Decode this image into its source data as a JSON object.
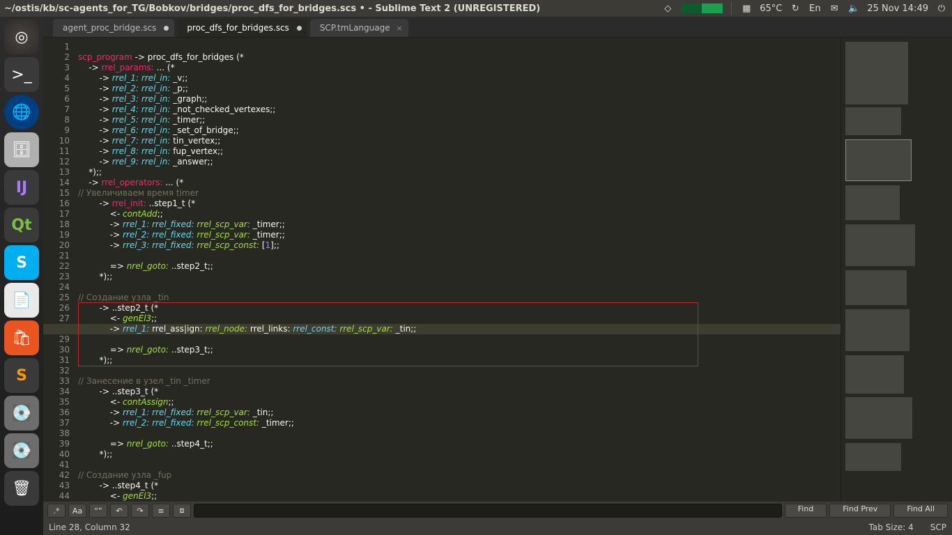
{
  "menubar": {
    "title": "~/ostis/kb/sc-agents_for_TG/Bobkov/bridges/proc_dfs_for_bridges.scs • - Sublime Text 2 (UNREGISTERED)",
    "temp": "65°C",
    "lang": "En",
    "datetime": "25 Nov 14:49"
  },
  "launcher": {
    "items": [
      {
        "name": "ubuntu-dash",
        "glyph": "◎"
      },
      {
        "name": "terminal",
        "glyph": ">_"
      },
      {
        "name": "firefox",
        "glyph": "🦊"
      },
      {
        "name": "files",
        "glyph": "🗄"
      },
      {
        "name": "intellij",
        "glyph": "IJ"
      },
      {
        "name": "qt-creator",
        "glyph": "Qt"
      },
      {
        "name": "skype",
        "glyph": "S"
      },
      {
        "name": "libreoffice-writer",
        "glyph": "📄"
      },
      {
        "name": "software-center",
        "glyph": "🛍"
      },
      {
        "name": "sublime-text",
        "glyph": "S"
      },
      {
        "name": "disk-1",
        "glyph": "💽"
      },
      {
        "name": "disk-2",
        "glyph": "💽"
      },
      {
        "name": "trash",
        "glyph": "🗑"
      }
    ]
  },
  "tabs": [
    {
      "label": "agent_proc_bridge.scs",
      "state": "dirty"
    },
    {
      "label": "proc_dfs_for_bridges.scs",
      "state": "dirty",
      "active": true
    },
    {
      "label": "SCP.tmLanguage",
      "state": "close"
    }
  ],
  "code": {
    "lines": [
      {
        "n": 1,
        "html": ""
      },
      {
        "n": 2,
        "html": "<span class='kw1'>scp_program</span><span class='id'> -&gt; proc_dfs_for_bridges (*</span>"
      },
      {
        "n": 3,
        "html": "<span class='id'>    -&gt; </span><span class='kw1'>rrel_params:</span><span class='id'> ... (*</span>"
      },
      {
        "n": 4,
        "html": "<span class='id'>        -&gt; </span><span class='ty'>rrel_1:</span><span class='id'> </span><span class='ty'>rrel_in:</span><span class='id'> _v;;</span>"
      },
      {
        "n": 5,
        "html": "<span class='id'>        -&gt; </span><span class='ty'>rrel_2:</span><span class='id'> </span><span class='ty'>rrel_in:</span><span class='id'> _p;;</span>"
      },
      {
        "n": 6,
        "html": "<span class='id'>        -&gt; </span><span class='ty'>rrel_3:</span><span class='id'> </span><span class='ty'>rrel_in:</span><span class='id'> _graph;;</span>"
      },
      {
        "n": 7,
        "html": "<span class='id'>        -&gt; </span><span class='ty'>rrel_4:</span><span class='id'> </span><span class='ty'>rrel_in:</span><span class='id'> _not_checked_vertexes;;</span>"
      },
      {
        "n": 8,
        "html": "<span class='id'>        -&gt; </span><span class='ty'>rrel_5:</span><span class='id'> </span><span class='ty'>rrel_in:</span><span class='id'> _timer;;</span>"
      },
      {
        "n": 9,
        "html": "<span class='id'>        -&gt; </span><span class='ty'>rrel_6:</span><span class='id'> </span><span class='ty'>rrel_in:</span><span class='id'> _set_of_bridge;;</span>"
      },
      {
        "n": 10,
        "html": "<span class='id'>        -&gt; </span><span class='ty'>rrel_7:</span><span class='id'> </span><span class='ty'>rrel_in:</span><span class='id'> tin_vertex;;</span>"
      },
      {
        "n": 11,
        "html": "<span class='id'>        -&gt; </span><span class='ty'>rrel_8:</span><span class='id'> </span><span class='ty'>rrel_in:</span><span class='id'> fup_vertex;;</span>"
      },
      {
        "n": 12,
        "html": "<span class='id'>        -&gt; </span><span class='ty'>rrel_9:</span><span class='id'> </span><span class='ty'>rrel_in:</span><span class='id'> _answer;;</span>"
      },
      {
        "n": 13,
        "html": "<span class='id'>    *);;</span>"
      },
      {
        "n": 14,
        "html": "<span class='id'>    -&gt; </span><span class='kw1'>rrel_operators:</span><span class='id'> ... (*</span>"
      },
      {
        "n": 15,
        "html": "<span class='cmt'>// Увеличиваем время timer</span>"
      },
      {
        "n": 16,
        "html": "<span class='id'>        -&gt; </span><span class='kw1'>rrel_init:</span><span class='id'> ..step1_t (*</span>"
      },
      {
        "n": 17,
        "html": "<span class='id'>            &lt;- </span><span class='ty2'>contAdd</span><span class='id'>;;</span>"
      },
      {
        "n": 18,
        "html": "<span class='id'>            -&gt; </span><span class='ty'>rrel_1:</span><span class='id'> </span><span class='ty'>rrel_fixed:</span><span class='id'> </span><span class='ty2'>rrel_scp_var:</span><span class='id'> _timer;;</span>"
      },
      {
        "n": 19,
        "html": "<span class='id'>            -&gt; </span><span class='ty'>rrel_2:</span><span class='id'> </span><span class='ty'>rrel_fixed:</span><span class='id'> </span><span class='ty2'>rrel_scp_var:</span><span class='id'> _timer;;</span>"
      },
      {
        "n": 20,
        "html": "<span class='id'>            -&gt; </span><span class='ty'>rrel_3:</span><span class='id'> </span><span class='ty'>rrel_fixed:</span><span class='id'> </span><span class='ty2'>rrel_scp_const:</span><span class='id'> [</span><span class='num'>1</span><span class='id'>];;</span>"
      },
      {
        "n": 21,
        "html": ""
      },
      {
        "n": 22,
        "html": "<span class='id'>            =&gt; </span><span class='ty2'>nrel_goto:</span><span class='id'> ..step2_t;;</span>"
      },
      {
        "n": 23,
        "html": "<span class='id'>        *);;</span>"
      },
      {
        "n": 24,
        "html": ""
      },
      {
        "n": 25,
        "html": "<span class='cmt'>// Создание узла _tin</span>"
      },
      {
        "n": 26,
        "html": "<span class='id'>        -&gt; ..step2_t (*</span>"
      },
      {
        "n": 27,
        "html": "<span class='id'>            &lt;- </span><span class='ty2'>genEl3</span><span class='id'>;;</span>"
      },
      {
        "n": 28,
        "html": "<span class='id'>            -&gt; </span><span class='ty'>rrel_1:</span><span class='id'> rrel_ass|ign: </span><span class='ty2'>rrel_node:</span><span class='id'> rrel_links: </span><span class='ty'>rrel_const:</span><span class='id'> </span><span class='ty2'>rrel_scp_var:</span><span class='id'> _tin;;</span>"
      },
      {
        "n": 29,
        "html": ""
      },
      {
        "n": 30,
        "html": "<span class='id'>            =&gt; </span><span class='ty2'>nrel_goto:</span><span class='id'> ..step3_t;;</span>"
      },
      {
        "n": 31,
        "html": "<span class='id'>        *);;</span>"
      },
      {
        "n": 32,
        "html": ""
      },
      {
        "n": 33,
        "html": "<span class='cmt'>// Занесение в узел _tin _timer</span>"
      },
      {
        "n": 34,
        "html": "<span class='id'>        -&gt; ..step3_t (*</span>"
      },
      {
        "n": 35,
        "html": "<span class='id'>            &lt;- </span><span class='ty2'>contAssign</span><span class='id'>;;</span>"
      },
      {
        "n": 36,
        "html": "<span class='id'>            -&gt; </span><span class='ty'>rrel_1:</span><span class='id'> </span><span class='ty'>rrel_fixed:</span><span class='id'> </span><span class='ty2'>rrel_scp_var:</span><span class='id'> _tin;;</span>"
      },
      {
        "n": 37,
        "html": "<span class='id'>            -&gt; </span><span class='ty'>rrel_2:</span><span class='id'> </span><span class='ty'>rrel_fixed:</span><span class='id'> </span><span class='ty2'>rrel_scp_const:</span><span class='id'> _timer;;</span>"
      },
      {
        "n": 38,
        "html": ""
      },
      {
        "n": 39,
        "html": "<span class='id'>            =&gt; </span><span class='ty2'>nrel_goto:</span><span class='id'> ..step4_t;;</span>"
      },
      {
        "n": 40,
        "html": "<span class='id'>        *);;</span>"
      },
      {
        "n": 41,
        "html": ""
      },
      {
        "n": 42,
        "html": "<span class='cmt'>// Создание узла _fup</span>"
      },
      {
        "n": 43,
        "html": "<span class='id'>        -&gt; ..step4_t (*</span>"
      },
      {
        "n": 44,
        "html": "<span class='id'>            &lt;- </span><span class='ty2'>genEl3</span><span class='id'>;;</span>"
      }
    ],
    "cursor_line_index": 27,
    "highlight_box": {
      "from": 25,
      "to": 30
    }
  },
  "searchbar": {
    "toggles": [
      ".*",
      "Aa",
      "“”",
      "↶",
      "↷",
      "≡",
      "⧈"
    ],
    "placeholder": "",
    "find": "Find",
    "findprev": "Find Prev",
    "findall": "Find All"
  },
  "statusbar": {
    "left": "Line 28, Column 32",
    "tabsize": "Tab Size: 4",
    "syntax": "SCP"
  }
}
